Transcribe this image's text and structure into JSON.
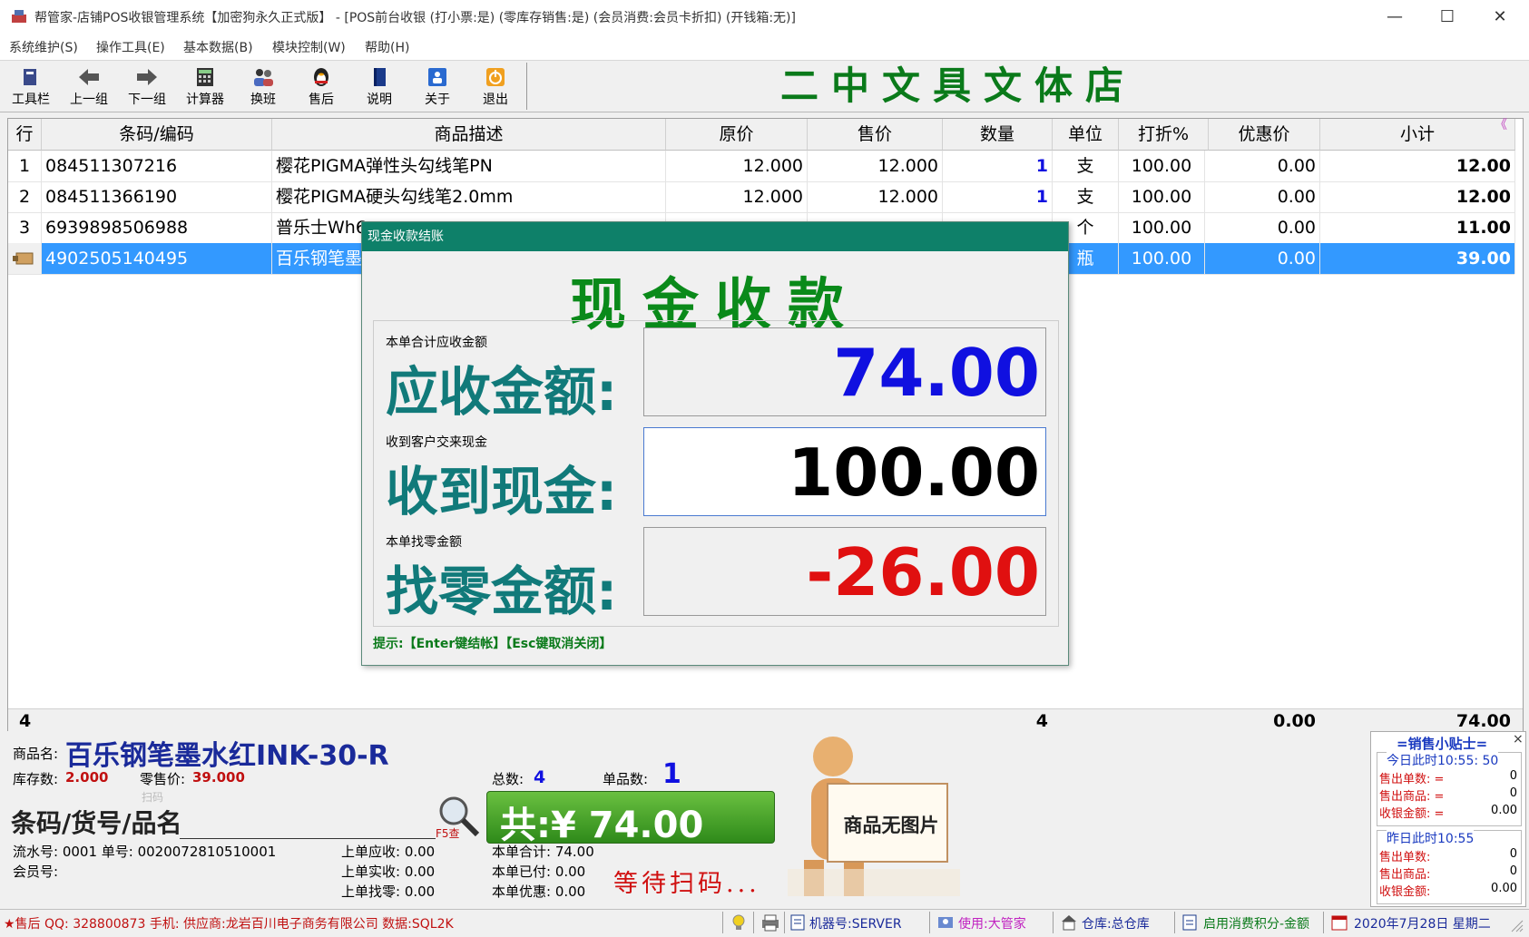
{
  "window": {
    "title": "帮管家-店铺POS收银管理系统【加密狗永久正式版】 - [POS前台收银 (打小票:是) (零库存销售:是) (会员消费:会员卡折扣) (开钱箱:无)]",
    "minimize": "—",
    "maximize": "☐",
    "close": "✕"
  },
  "menu": [
    "系统维护(S)",
    "操作工具(E)",
    "基本数据(B)",
    "模块控制(W)",
    "帮助(H)"
  ],
  "toolbar": [
    "工具栏",
    "上一组",
    "下一组",
    "计算器",
    "换班",
    "售后",
    "说明",
    "关于",
    "退出"
  ],
  "store_name": "二中文具文体店",
  "grid": {
    "headers": [
      "行",
      "条码/编码",
      "商品描述",
      "原价",
      "售价",
      "数量",
      "单位",
      "打折%",
      "优惠价",
      "小计"
    ],
    "corner": "《",
    "rows": [
      {
        "no": "1",
        "code": "084511307216",
        "desc": "樱花PIGMA弹性头勾线笔PN",
        "orig": "12.000",
        "price": "12.000",
        "qty": "1",
        "unit": "支",
        "disc": "100.00",
        "deal": "0.00",
        "sub": "12.00"
      },
      {
        "no": "2",
        "code": "084511366190",
        "desc": "樱花PIGMA硬头勾线笔2.0mm",
        "orig": "12.000",
        "price": "12.000",
        "qty": "1",
        "unit": "支",
        "disc": "100.00",
        "deal": "0.00",
        "sub": "12.00"
      },
      {
        "no": "3",
        "code": "6939898506988",
        "desc": "普乐士Wh6",
        "orig": "",
        "price": "",
        "qty": "",
        "unit": "个",
        "disc": "100.00",
        "deal": "0.00",
        "sub": "11.00"
      },
      {
        "no": "",
        "code": "4902505140495",
        "desc": "百乐钢笔墨水",
        "orig": "",
        "price": "",
        "qty": "",
        "unit": "瓶",
        "disc": "100.00",
        "deal": "0.00",
        "sub": "39.00"
      }
    ],
    "footer": {
      "rows": "4",
      "qty": "4",
      "deal": "0.00",
      "sub": "74.00"
    }
  },
  "dialog": {
    "caption": "现金收款结账",
    "title": "现金收款",
    "due_small": "本单合计应收金额",
    "due_label": "应收金额:",
    "due_value": "74.00",
    "recv_small": "收到客户交来现金",
    "recv_label": "收到现金:",
    "recv_value": "100.00",
    "change_small": "本单找零金额",
    "change_label": "找零金额:",
    "change_value": "-26.00",
    "hint": "提示:【Enter键结帐】【Esc键取消关闭】"
  },
  "bottom": {
    "name_label": "商品名:",
    "name_value": "百乐钢笔墨水红INK-30-R",
    "stock_label": "库存数:",
    "stock_value": "2.000",
    "retail_label": "零售价:",
    "retail_value": "39.000",
    "total_count_label": "总数:",
    "total_count_value": "4",
    "item_count_label": "单品数:",
    "item_count_value": "1",
    "scan_label": "条码/货号/品名/拼音:",
    "scan_hint": "扫码",
    "f5": "F5查",
    "grand_total": "共:¥ 74.00",
    "serial": "流水号: 0001 单号: 0020072810510001",
    "member": "会员号:",
    "last_due": "上单应收: 0.00",
    "last_paid": "上单实收: 0.00",
    "last_change": "上单找零: 0.00",
    "cur_total": "本单合计: 74.00",
    "cur_paid": "本单已付: 0.00",
    "cur_discount": "本单优惠: 0.00",
    "waiting": "等待扫码...",
    "no_image": "商品无图片"
  },
  "tips": {
    "title": "=销售小贴士=",
    "close": "×",
    "today": "今日此时10:55: 50",
    "today_items": [
      {
        "label": "售出单数: =",
        "value": "0"
      },
      {
        "label": "售出商品: =",
        "value": "0"
      },
      {
        "label": "收银金额: =",
        "value": "0.00"
      }
    ],
    "yesterday": "昨日此时10:55",
    "yesterday_items": [
      {
        "label": "售出单数:",
        "value": "0"
      },
      {
        "label": "售出商品:",
        "value": "0"
      },
      {
        "label": "收银金额:",
        "value": "0.00"
      }
    ]
  },
  "status": {
    "support": "★售后 QQ: 328800873 手机:  供应商:龙岩百川电子商务有限公司 数据:SQL2K",
    "machine": "机器号:SERVER",
    "user": "使用:大管家",
    "warehouse": "仓库:总仓库",
    "points": "启用消费积分-金额",
    "date": "2020年7月28日  星期二"
  },
  "colors": {
    "accent_green": "#0a8a1a",
    "teal": "#0e8069",
    "selection": "#3399ff",
    "due_blue": "#1010e0",
    "change_red": "#e01010"
  }
}
